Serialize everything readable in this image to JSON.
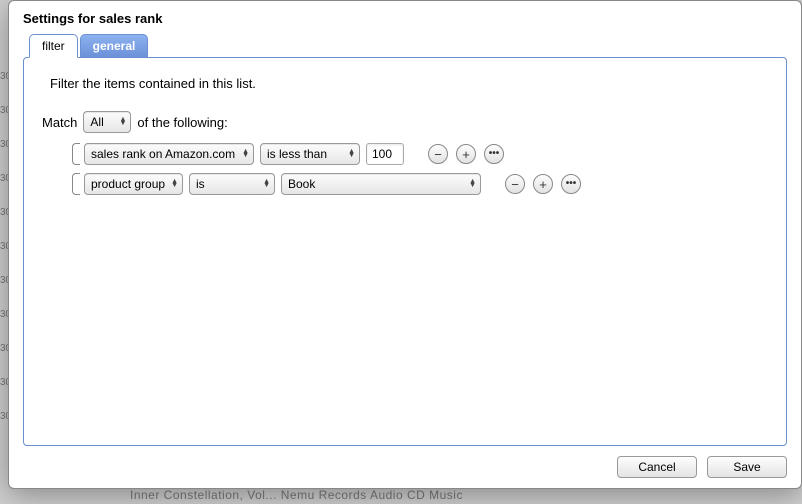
{
  "dialog": {
    "title": "Settings for sales rank"
  },
  "tabs": {
    "filter": "filter",
    "general": "general"
  },
  "filter_panel": {
    "intro": "Filter the items contained in this list.",
    "match_prefix": "Match",
    "match_mode": "All",
    "match_suffix": "of the following:",
    "rules": [
      {
        "field": "sales rank on Amazon.com",
        "operator": "is less than",
        "value": "100",
        "value_type": "text"
      },
      {
        "field": "product group",
        "operator": "is",
        "value": "Book",
        "value_type": "select"
      }
    ]
  },
  "buttons": {
    "cancel": "Cancel",
    "save": "Save"
  },
  "backdrop": {
    "bottom": "Inner Constellation, Vol...                                        Nemu Records Audio CD             Music"
  }
}
